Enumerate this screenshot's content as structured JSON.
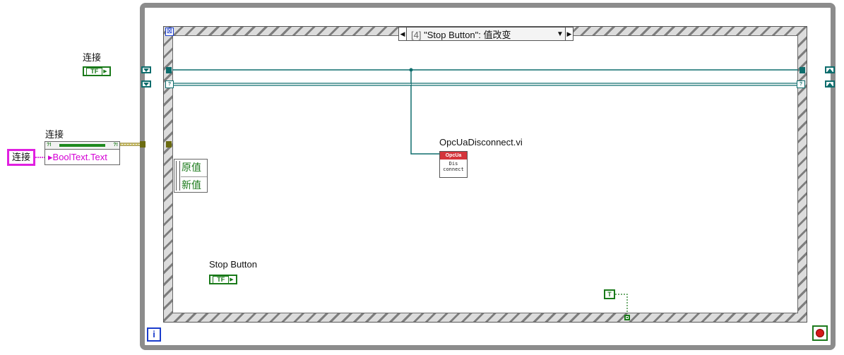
{
  "case_selector": {
    "index": "[4]",
    "event": "\"Stop Button\": 值改变",
    "prev_arrow": "◀",
    "next_arrow": "▶",
    "dropdown": "▼"
  },
  "dynamic_events_icon": "⊠",
  "iteration_terminal": "i",
  "controls": {
    "connect_bool_label": "连接",
    "connect_bool_glyph": "TF",
    "stop_button_label": "Stop Button",
    "stop_button_glyph": "TF"
  },
  "property_node": {
    "label": "连接",
    "property": "BoolText.Text",
    "ref_glyph": "?!"
  },
  "string_constant": "连接",
  "event_data": {
    "old_value": "原值",
    "new_value": "新值"
  },
  "subvi": {
    "label": "OpcUaDisconnect.vi",
    "header": "OpcUa",
    "icon_text": "Dis\nconnect"
  },
  "true_constant": "T",
  "colors": {
    "refnum_wire": "#0e6d6d",
    "boolean": "#1a7a1a",
    "string": "#d400d4",
    "loop_border": "#8c8c8c",
    "structure_blue": "#1a3ccc",
    "stop_red": "#d41a1a"
  }
}
